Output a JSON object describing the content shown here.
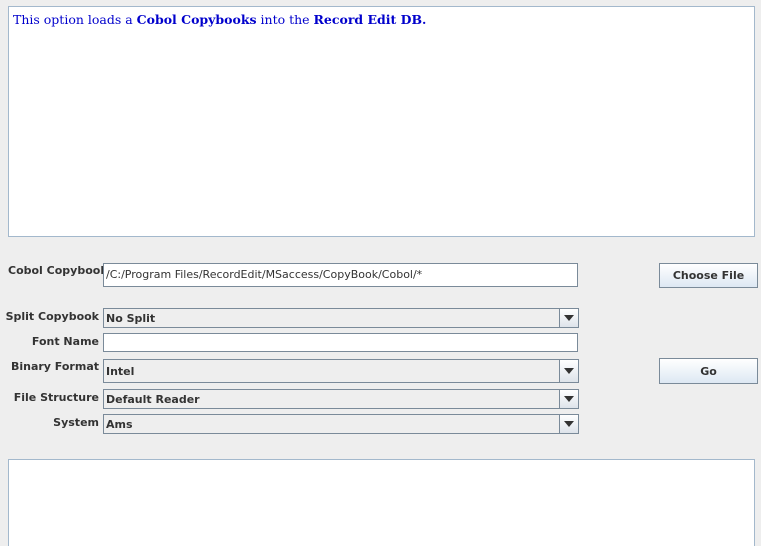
{
  "help": {
    "prefix": "This option loads a ",
    "copybooks": "Cobol Copybooks",
    "middle": " into the ",
    "db": "Record Edit DB."
  },
  "form": {
    "copybook": {
      "label": "Cobol Copybook",
      "value": "/C:/Program Files/RecordEdit/MSaccess/CopyBook/Cobol/*"
    },
    "split": {
      "label": "Split Copybook",
      "value": "No Split"
    },
    "font": {
      "label": "Font Name",
      "value": ""
    },
    "binary": {
      "label": "Binary Format",
      "value": "Intel"
    },
    "structure": {
      "label": "File Structure",
      "value": "Default Reader"
    },
    "system": {
      "label": "System",
      "value": "Ams"
    }
  },
  "buttons": {
    "choose_file": "Choose File",
    "go": "Go"
  },
  "output": {
    "text": ""
  }
}
